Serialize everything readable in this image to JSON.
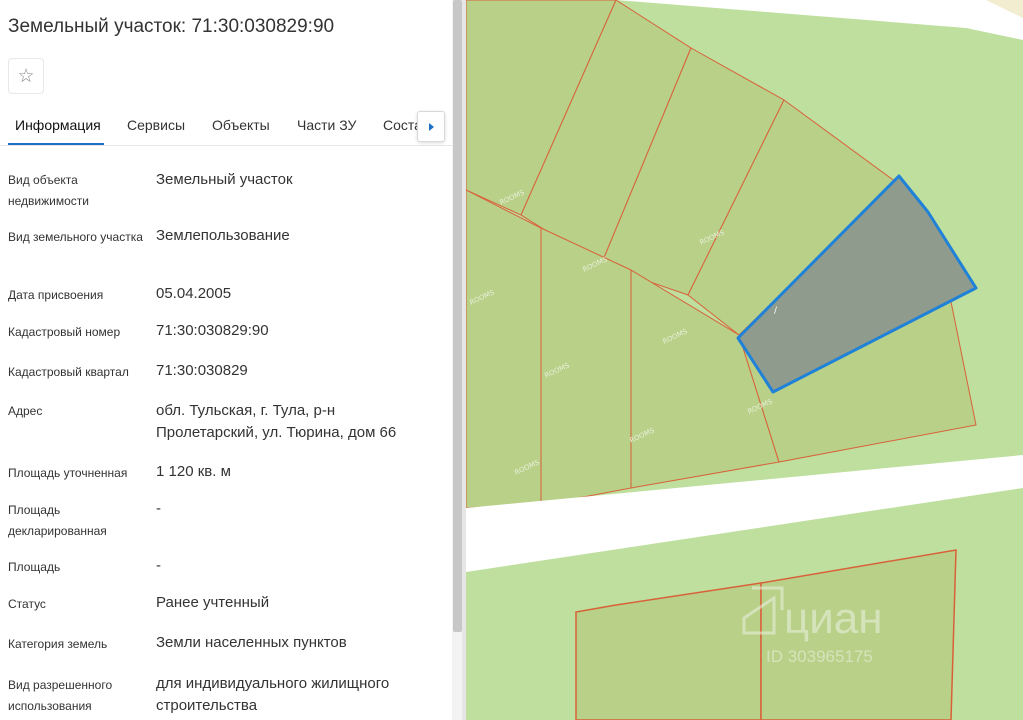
{
  "header": {
    "title": "Земельный участок: 71:30:030829:90",
    "star_icon": "☆"
  },
  "tabs": [
    {
      "label": "Информация",
      "active": true
    },
    {
      "label": "Сервисы",
      "active": false
    },
    {
      "label": "Объекты",
      "active": false
    },
    {
      "label": "Части ЗУ",
      "active": false
    },
    {
      "label": "Состав",
      "active": false
    }
  ],
  "properties": [
    {
      "label": "Вид объекта недвижимости",
      "value": "Земельный участок"
    },
    {
      "label": "Вид земельного участка",
      "value": "Землепользование"
    },
    {
      "label": "Дата присвоения",
      "value": "05.04.2005"
    },
    {
      "label": "Кадастровый номер",
      "value": "71:30:030829:90"
    },
    {
      "label": "Кадастровый квартал",
      "value": "71:30:030829"
    },
    {
      "label": "Адрес",
      "value": "обл. Тульская, г. Тула, р-н Пролетарский, ул. Тюрина, дом 66"
    },
    {
      "label": "Площадь уточненная",
      "value": "1 120 кв. м"
    },
    {
      "label": "Площадь декларированная",
      "value": "-"
    },
    {
      "label": "Площадь",
      "value": "-"
    },
    {
      "label": "Статус",
      "value": "Ранее учтенный"
    },
    {
      "label": "Категория земель",
      "value": "Земли населенных пунктов"
    },
    {
      "label": "Вид разрешенного использования",
      "value": "для индивидуального жилищного строительства"
    }
  ],
  "map": {
    "watermark_brand": "циан",
    "watermark_id": "ID 303965175",
    "rooms_mark": "ROOMS",
    "plot_marker": "/",
    "colors": {
      "land": "#bedf9d",
      "parcel_fill": "#b8d088",
      "parcel_border": "#d9613a",
      "selected_fill": "#8f9b8d",
      "selected_border": "#1f82d8",
      "road": "#ffffff"
    }
  }
}
